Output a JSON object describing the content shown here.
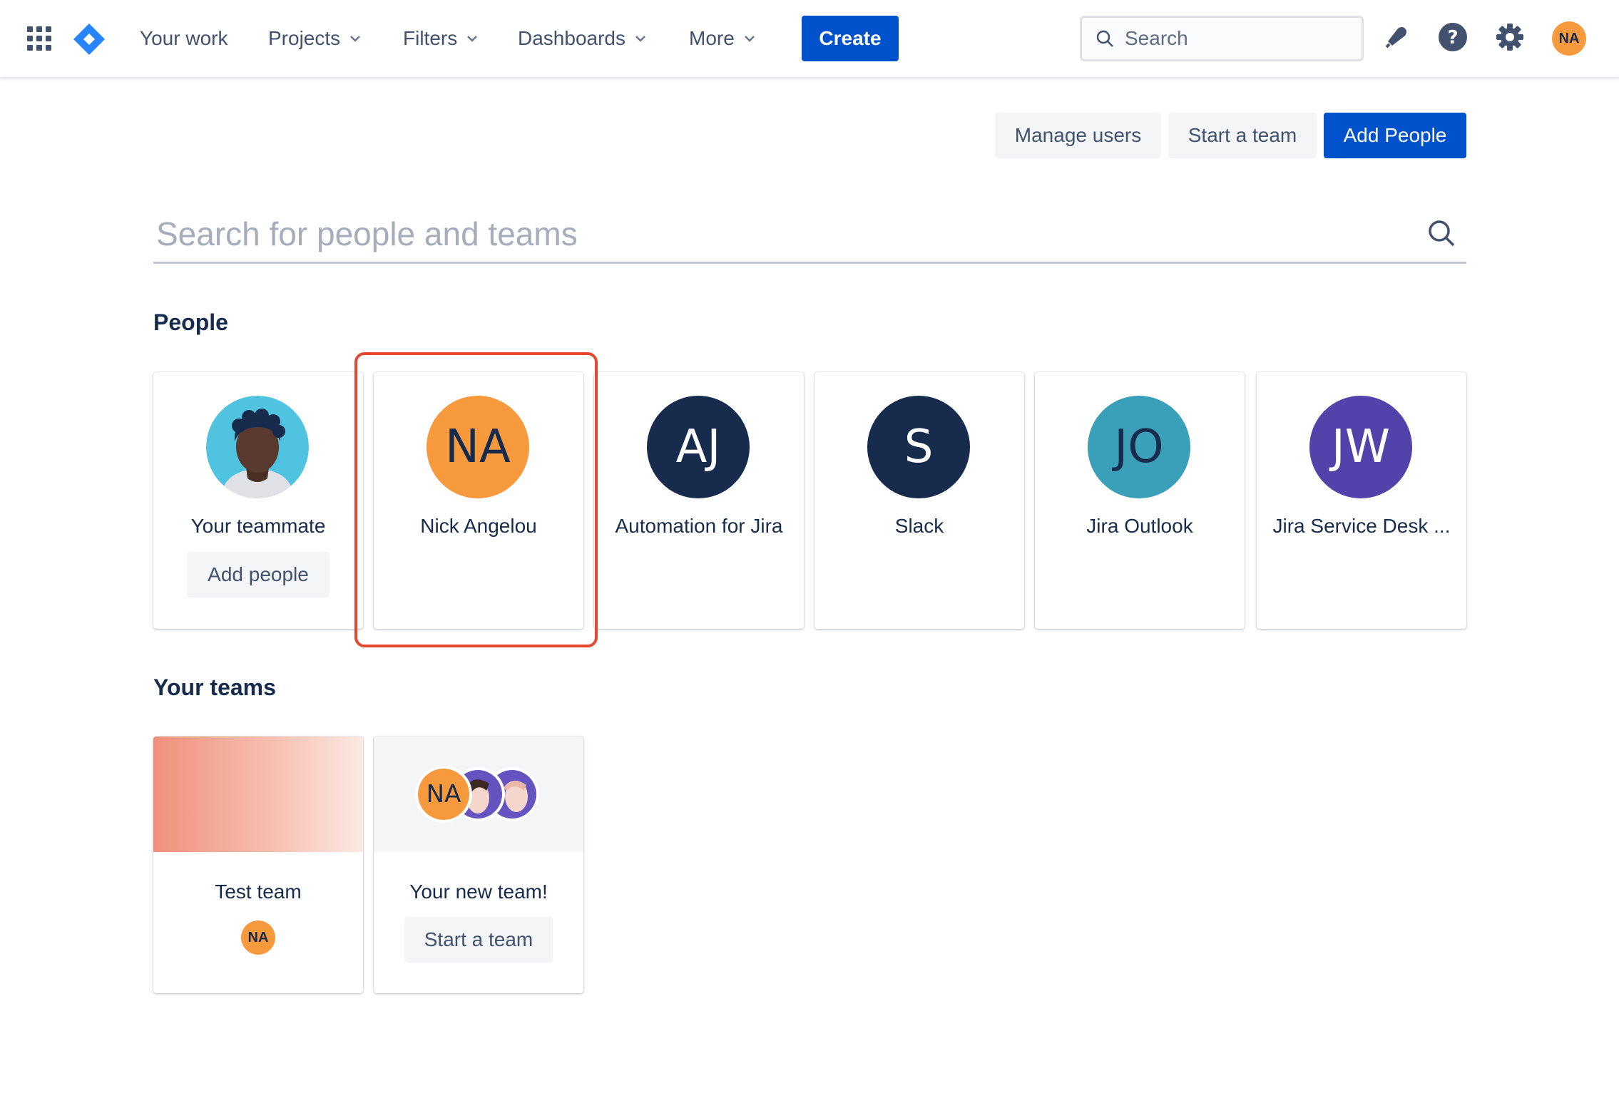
{
  "nav": {
    "items": [
      {
        "label": "Your work",
        "dropdown": false
      },
      {
        "label": "Projects",
        "dropdown": true
      },
      {
        "label": "Filters",
        "dropdown": true
      },
      {
        "label": "Dashboards",
        "dropdown": true
      },
      {
        "label": "More",
        "dropdown": true
      }
    ],
    "create_label": "Create",
    "search_placeholder": "Search",
    "user_initials": "NA"
  },
  "actions": {
    "manage_users": "Manage users",
    "start_team": "Start a team",
    "add_people": "Add People"
  },
  "people_search": {
    "placeholder": "Search for people and teams"
  },
  "people": {
    "title": "People",
    "cards": [
      {
        "name": "Your teammate",
        "initials": "",
        "color": "#4FC3E0",
        "button": "Add people"
      },
      {
        "name": "Nick Angelou",
        "initials": "NA",
        "color": "#F79A3E"
      },
      {
        "name": "Automation for Jira",
        "initials": "AJ",
        "color": "#172B4D"
      },
      {
        "name": "Slack",
        "initials": "S",
        "color": "#172B4D"
      },
      {
        "name": "Jira Outlook",
        "initials": "JO",
        "color": "#3A9FB8"
      },
      {
        "name": "Jira Service Desk ...",
        "initials": "JW",
        "color": "#5243AA"
      }
    ]
  },
  "teams": {
    "title": "Your teams",
    "cards": [
      {
        "name": "Test team",
        "member_initials": "NA"
      },
      {
        "name": "Your new team!",
        "member_initials": "NA",
        "button": "Start a team"
      }
    ]
  },
  "colors": {
    "primary": "#0052CC",
    "highlight": "#E5482F",
    "avatar_orange": "#F79A3E"
  }
}
